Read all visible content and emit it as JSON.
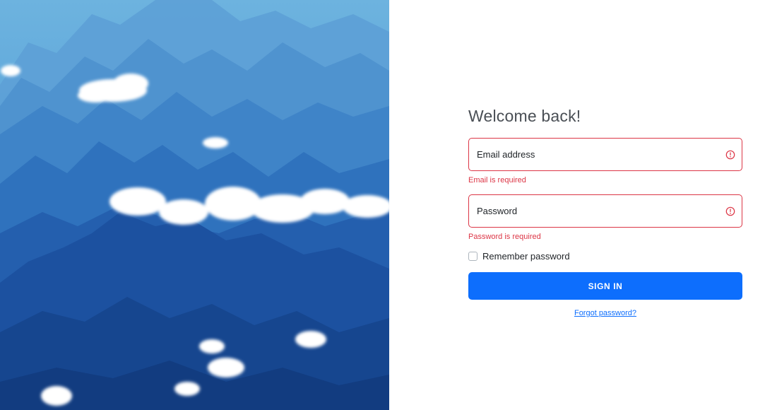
{
  "hero": {
    "image": "mountain-landscape-with-clouds"
  },
  "form": {
    "title": "Welcome back!",
    "email": {
      "placeholder": "Email address",
      "value": "",
      "error": "Email is required",
      "icon": "alert-circle-icon"
    },
    "password": {
      "placeholder": "Password",
      "value": "",
      "error": "Password is required",
      "icon": "alert-circle-icon"
    },
    "remember": {
      "label": "Remember password",
      "checked": false
    },
    "signin_label": "SIGN IN",
    "forgot_label": "Forgot password?"
  },
  "colors": {
    "primary": "#0d6efd",
    "danger": "#dc3545",
    "title": "#4a4f55"
  }
}
